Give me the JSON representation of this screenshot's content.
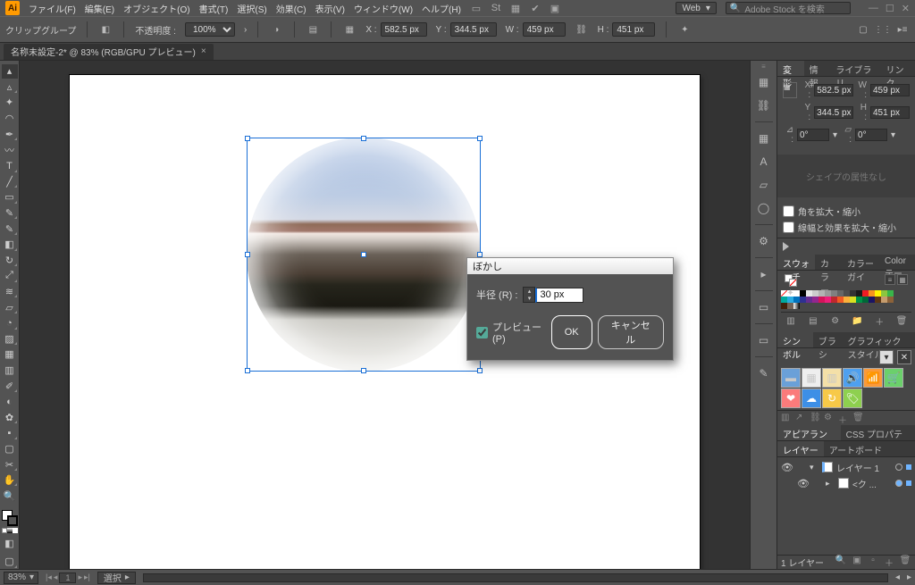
{
  "app": {
    "logo_text": "Ai",
    "workspace": "Web",
    "stock_placeholder": "Adobe Stock を検索"
  },
  "menu": {
    "file": "ファイル(F)",
    "edit": "編集(E)",
    "object": "オブジェクト(O)",
    "type": "書式(T)",
    "select": "選択(S)",
    "effect": "効果(C)",
    "view": "表示(V)",
    "window": "ウィンドウ(W)",
    "help": "ヘルプ(H)"
  },
  "control": {
    "selection_label": "クリップグループ",
    "opacity_label": "不透明度 :",
    "opacity_value": "100%",
    "x_label": "X :",
    "x_value": "582.5 px",
    "y_label": "Y :",
    "y_value": "344.5 px",
    "w_label": "W :",
    "w_value": "459 px",
    "h_label": "H :",
    "h_value": "451 px"
  },
  "tab": {
    "title": "名称未設定-2* @ 83% (RGB/GPU プレビュー)"
  },
  "transform_panel": {
    "tabs": {
      "transform": "変形",
      "info": "情報",
      "library": "ライブラリ",
      "link": "リンク"
    },
    "x_label": "X :",
    "x_value": "582.5 px",
    "y_label": "Y :",
    "y_value": "344.5 px",
    "w_label": "W :",
    "w_value": "459 px",
    "h_label": "H :",
    "h_value": "451 px",
    "rot_label": "⊿ :",
    "rot_value": "0°",
    "shear_value": "0°",
    "shape_placeholder": "シェイプの属性なし",
    "expand_corners": "角を拡大・縮小",
    "expand_strokes": "線幅と効果を拡大・縮小"
  },
  "swatches_panel": {
    "tabs": {
      "swatches": "スウォッチ",
      "color": "カラー",
      "colorguide": "カラーガイ",
      "colort": "Color テー"
    }
  },
  "symbols_panel": {
    "tabs": {
      "symbols": "シンボル",
      "brushes": "ブラシ",
      "graphicstyles": "グラフィックスタイル"
    }
  },
  "appearance_panel": {
    "tabs": {
      "appearance": "アピアランス",
      "css": "CSS プロパティ"
    }
  },
  "layers_panel": {
    "tabs": {
      "layers": "レイヤー",
      "artboards": "アートボード"
    },
    "layer1_name": "レイヤー 1",
    "clip_name": "<ク ...",
    "footer_count": "1 レイヤー"
  },
  "status": {
    "zoom": "83%",
    "selection": "選択"
  },
  "dialog": {
    "title": "ぼかし",
    "radius_label": "半径 (R) :",
    "radius_value": "30 px",
    "preview_label": "プレビュー (P)",
    "ok": "OK",
    "cancel": "キャンセル"
  },
  "swatch_colors": [
    "#ffffff",
    "#000000",
    "#e6e6e6",
    "#cccccc",
    "#b3b3b3",
    "#999999",
    "#808080",
    "#666666",
    "#4d4d4d",
    "#333333",
    "#1a1a1a",
    "#ed1c24",
    "#f7931e",
    "#fff200",
    "#8cc63f",
    "#39b54a",
    "#00a99d",
    "#29abe2",
    "#0071bc",
    "#2e3192",
    "#662d91",
    "#93278f",
    "#d4145a",
    "#ed1e79",
    "#c1272d",
    "#f15a24",
    "#fbb03b",
    "#d9e021",
    "#009245",
    "#006837",
    "#1b1464",
    "#603813",
    "#c69c6d",
    "#8c6239",
    "#42210b",
    "#736357"
  ],
  "panel_strip_icons": [
    "tile-icon",
    "link-icon",
    "tile-icon",
    "character-icon",
    "distort-icon",
    "world-icon",
    "gear-icon",
    "triangle-icon",
    "book-icon",
    "book-icon",
    "brush-icon"
  ]
}
